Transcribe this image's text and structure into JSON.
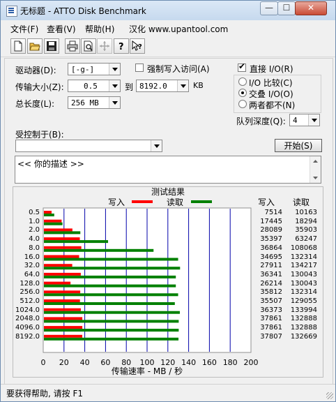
{
  "window": {
    "title": "无标题 - ATTO Disk Benchmark",
    "min_label": "—",
    "max_label": "☐",
    "close_label": "✕"
  },
  "menu": [
    {
      "label": "文件(F)"
    },
    {
      "label": "查看(V)"
    },
    {
      "label": "帮助(H)"
    },
    {
      "label": "汉化 www.upantool.com"
    }
  ],
  "toolbar": [
    {
      "icon": "new-icon"
    },
    {
      "icon": "open-icon"
    },
    {
      "icon": "save-icon"
    },
    {
      "icon": "print-icon"
    },
    {
      "icon": "print-preview-icon"
    },
    {
      "icon": "move-icon"
    },
    {
      "icon": "help-icon"
    },
    {
      "icon": "context-help-icon"
    }
  ],
  "form": {
    "drive_label": "驱动器(D):",
    "drive_value": "[-g-]",
    "force_write_label": "强制写入访问(A)",
    "transfer_label": "传输大小(Z):",
    "transfer_from": "0.5",
    "to_label": "到",
    "transfer_to": "8192.0",
    "kb_label": "KB",
    "total_label": "总长度(L):",
    "total_value": "256 MB",
    "direct_io_label": "直接 I/O(R)",
    "io_compare_label": "I/O 比较(C)",
    "overlap_io_label": "交叠 I/O(O)",
    "neither_label": "两者都不(N)",
    "queue_label": "队列深度(Q):",
    "queue_value": "4",
    "controlled_label": "受控制于(B):",
    "controlled_value": "",
    "start_button": "开始(S)",
    "description": "<<  你的描述   >>"
  },
  "colors": {
    "write": "#ff0000",
    "read": "#008000",
    "grid": "#0000aa"
  },
  "results": {
    "title": "测试结果",
    "write_header": "写入",
    "read_header": "读取"
  },
  "chart_data": {
    "type": "bar",
    "title": "测试结果",
    "xlabel": "传输速率 - MB / 秒",
    "xlim": [
      0,
      200
    ],
    "x_ticks": [
      "0",
      "20",
      "40",
      "60",
      "80",
      "100",
      "120",
      "140",
      "160",
      "180",
      "200"
    ],
    "categories": [
      "0.5",
      "1.0",
      "2.0",
      "4.0",
      "8.0",
      "16.0",
      "32.0",
      "64.0",
      "128.0",
      "256.0",
      "512.0",
      "1024.0",
      "2048.0",
      "4096.0",
      "8192.0"
    ],
    "series": [
      {
        "name": "写入",
        "color": "#ff0000",
        "values": [
          7514,
          17445,
          28089,
          35397,
          36864,
          34695,
          27911,
          36341,
          26214,
          35812,
          35507,
          36373,
          37861,
          37861,
          37807
        ]
      },
      {
        "name": "读取",
        "color": "#008000",
        "values": [
          10163,
          18294,
          35903,
          63247,
          108068,
          132314,
          134217,
          130043,
          130043,
          132314,
          129055,
          133994,
          132888,
          132888,
          132669
        ]
      }
    ],
    "value_unit": "KB/s",
    "legend": "top"
  },
  "status": {
    "text": "要获得帮助, 请按 F1"
  }
}
